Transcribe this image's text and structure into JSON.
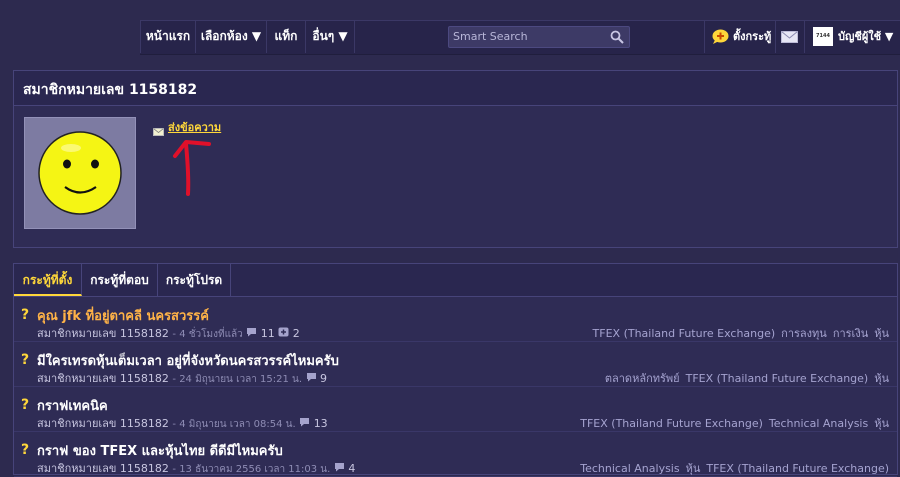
{
  "nav": {
    "items": [
      "หน้าแรก",
      "เลือกห้อง ▼",
      "แท็ก",
      "อื่นๆ ▼"
    ],
    "search_placeholder": "Smart Search",
    "new_topic": "ตั้งกระทู้",
    "account": "บัญชีผู้ใช้ ▼",
    "account_badge": "7144"
  },
  "profile": {
    "title": "สมาชิกหมายเลข 1158182",
    "send_message": "ส่งข้อความ"
  },
  "tabs": [
    "กระทู้ที่ตั้ง",
    "กระทู้ที่ตอบ",
    "กระทู้โปรด"
  ],
  "topics": [
    {
      "title": "คุณ jfk ที่อยู่ตาคลี นครสวรรค์",
      "author": "สมาชิกหมายเลข 1158182",
      "time": "- 4 ชั่วโมงที่แล้ว",
      "comments": "11",
      "plus": "2",
      "tags": [
        "TFEX (Thailand Future Exchange)",
        "การลงทุน",
        "การเงิน",
        "หุ้น"
      ]
    },
    {
      "title": "มีใครเทรดหุ้นเต็มเวลา อยู่ที่จังหวัดนครสวรรค์ไหมครับ",
      "author": "สมาชิกหมายเลข 1158182",
      "time": "- 24 มิถุนายน เวลา 15:21 น.",
      "comments": "9",
      "tags": [
        "ตลาดหลักทรัพย์",
        "TFEX (Thailand Future Exchange)",
        "หุ้น"
      ]
    },
    {
      "title": "กราฟเทคนิค",
      "author": "สมาชิกหมายเลข 1158182",
      "time": "- 4 มิถุนายน เวลา 08:54 น.",
      "comments": "13",
      "tags": [
        "TFEX (Thailand Future Exchange)",
        "Technical Analysis",
        "หุ้น"
      ]
    },
    {
      "title": "กราฟ ของ TFEX และหุ้นไทย ดีดีมีไหมครับ",
      "author": "สมาชิกหมายเลข 1158182",
      "time": "- 13 ธันวาคม 2556 เวลา 11:03 น.",
      "comments": "4",
      "tags": [
        "Technical Analysis",
        "หุ้น",
        "TFEX (Thailand Future Exchange)"
      ]
    }
  ]
}
